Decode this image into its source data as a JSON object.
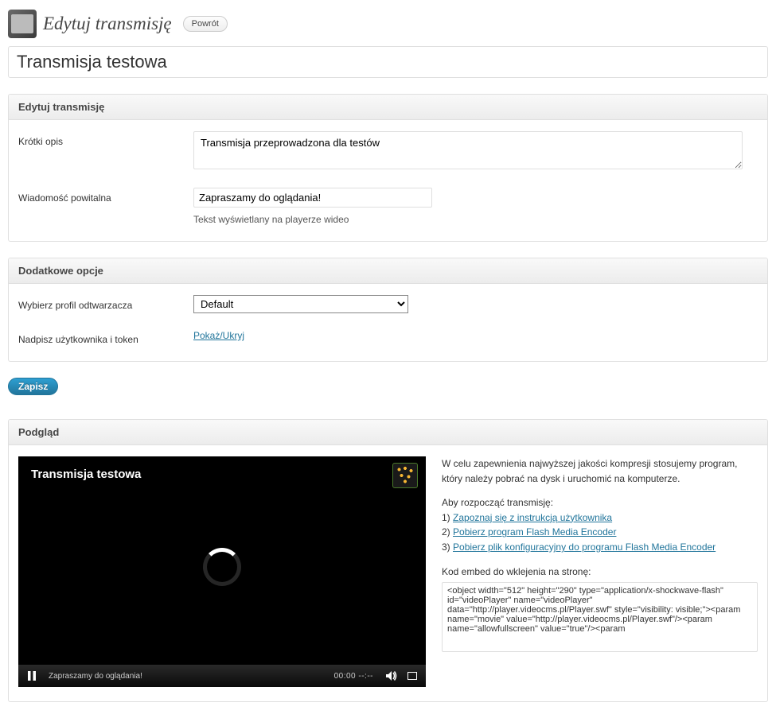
{
  "header": {
    "title": "Edytuj transmisję",
    "return_label": "Powrót"
  },
  "title_value": "Transmisja testowa",
  "panels": {
    "edit": {
      "heading": "Edytuj transmisję",
      "short_desc_label": "Krótki opis",
      "short_desc_value": "Transmisja przeprowadzona dla testów",
      "welcome_label": "Wiadomość powitalna",
      "welcome_value": "Zapraszamy do oglądania!",
      "welcome_help": "Tekst wyświetlany na playerze wideo"
    },
    "options": {
      "heading": "Dodatkowe opcje",
      "profile_label": "Wybierz profil odtwarzacza",
      "profile_value": "Default",
      "override_label": "Nadpisz użytkownika i token",
      "toggle_link": "Pokaż/Ukryj"
    },
    "preview": {
      "heading": "Podgląd",
      "player_title": "Transmisja testowa",
      "player_message": "Zapraszamy do oglądania!",
      "player_time": "00:00   --:--",
      "info_paragraph": "W celu zapewnienia najwyższej jakości kompresji stosujemy program, który należy pobrać na dysk i uruchomić na komputerze.",
      "steps_intro": "Aby rozpocząć transmisję:",
      "steps": {
        "s1": "Zapoznaj się z instrukcją użytkownika",
        "s2": "Pobierz program Flash Media Encoder",
        "s3": "Pobierz plik konfiguracyjny do programu Flash Media Encoder"
      },
      "embed_label": "Kod embed do wklejenia na stronę:",
      "embed_code": "<object width=\"512\" height=\"290\" type=\"application/x-shockwave-flash\" id=\"videoPlayer\" name=\"videoPlayer\" data=\"http://player.videocms.pl/Player.swf\" style=\"visibility: visible;\"><param name=\"movie\" value=\"http://player.videocms.pl/Player.swf\"/><param name=\"allowfullscreen\" value=\"true\"/><param"
    }
  },
  "save_label": "Zapisz"
}
